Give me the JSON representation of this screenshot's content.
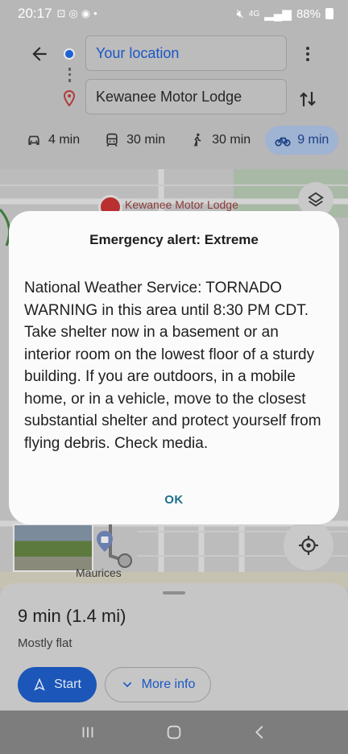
{
  "status_bar": {
    "time": "20:17",
    "battery": "88%",
    "network": "4G"
  },
  "directions": {
    "origin_value": "Your location",
    "destination_value": "Kewanee Motor Lodge",
    "modes": [
      {
        "name": "drive",
        "label": "4 min"
      },
      {
        "name": "transit",
        "label": "30 min"
      },
      {
        "name": "walk",
        "label": "30 min"
      },
      {
        "name": "bike",
        "label": "9 min",
        "selected": true
      }
    ]
  },
  "map": {
    "destination_label": "Kewanee Motor Lodge",
    "poi_label": "Maurices"
  },
  "route_summary": {
    "duration": "9 min (1.4 mi)",
    "terrain": "Mostly flat",
    "start_label": "Start",
    "more_info_label": "More info"
  },
  "alert": {
    "title": "Emergency alert: Extreme",
    "body": "National Weather Service: TORNADO WARNING in this area until 8:30 PM CDT. Take shelter now in a basement or an interior room on the lowest floor of a sturdy building. If you are outdoors, in a mobile home, or in a vehicle, move to the closest substantial shelter and protect yourself from flying debris. Check media.",
    "ok_label": "OK"
  },
  "colors": {
    "accent_blue": "#1a57c6",
    "selected_mode_bg": "#9fb3d2",
    "start_button_bg": "#1b56b8",
    "dialog_ok": "#1e6f8c"
  }
}
